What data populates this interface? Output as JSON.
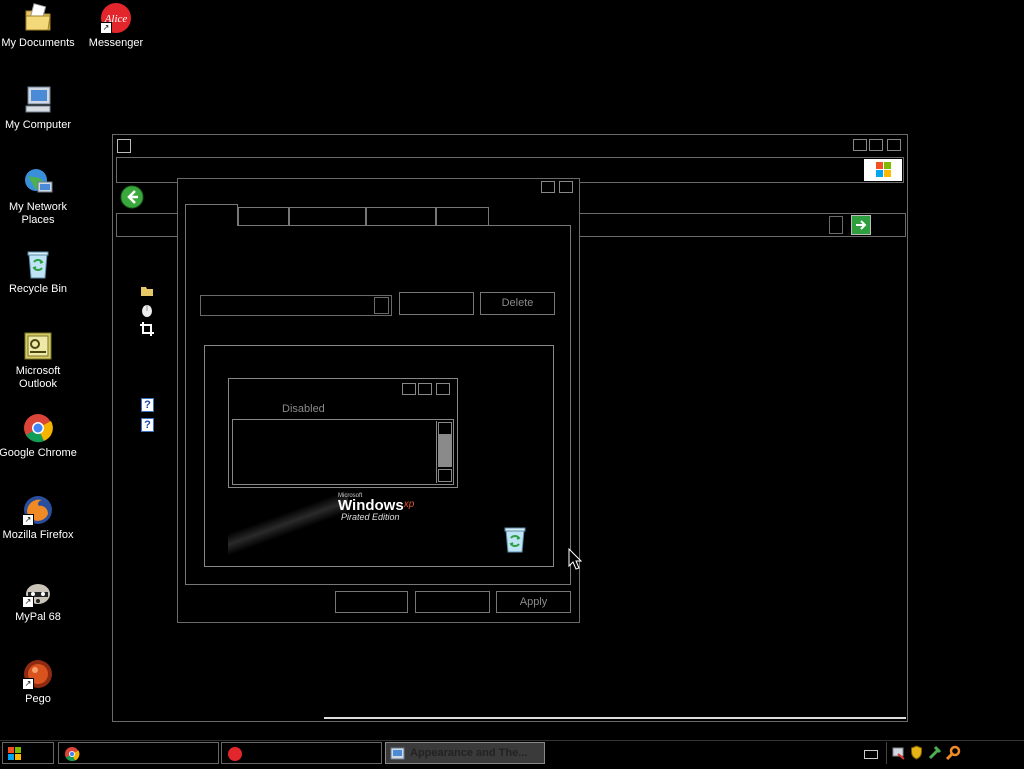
{
  "desktop": {
    "icons": [
      {
        "label": "My Documents"
      },
      {
        "label": "Messenger"
      },
      {
        "label": "My Computer"
      },
      {
        "label": "My Network Places"
      },
      {
        "label": "Recycle Bin"
      },
      {
        "label": "Microsoft Outlook"
      },
      {
        "label": "Google Chrome"
      },
      {
        "label": "Mozilla Firefox"
      },
      {
        "label": "MyPal 68"
      },
      {
        "label": "Pego"
      }
    ]
  },
  "dialog": {
    "scheme_select_value": "",
    "delete_label": "Delete",
    "preview_window_text": "Disabled",
    "logo": {
      "microsoft": "Microsoft",
      "windows": "Windows",
      "xp": "xp",
      "edition": "Pirated Edition"
    },
    "apply_label": "Apply"
  },
  "taskbar": {
    "active_item_label": "Appearance and The..."
  },
  "colors": {
    "background": "#000000",
    "disabled_text": "#8a8a8a",
    "go_green": "#2e9e3e"
  }
}
